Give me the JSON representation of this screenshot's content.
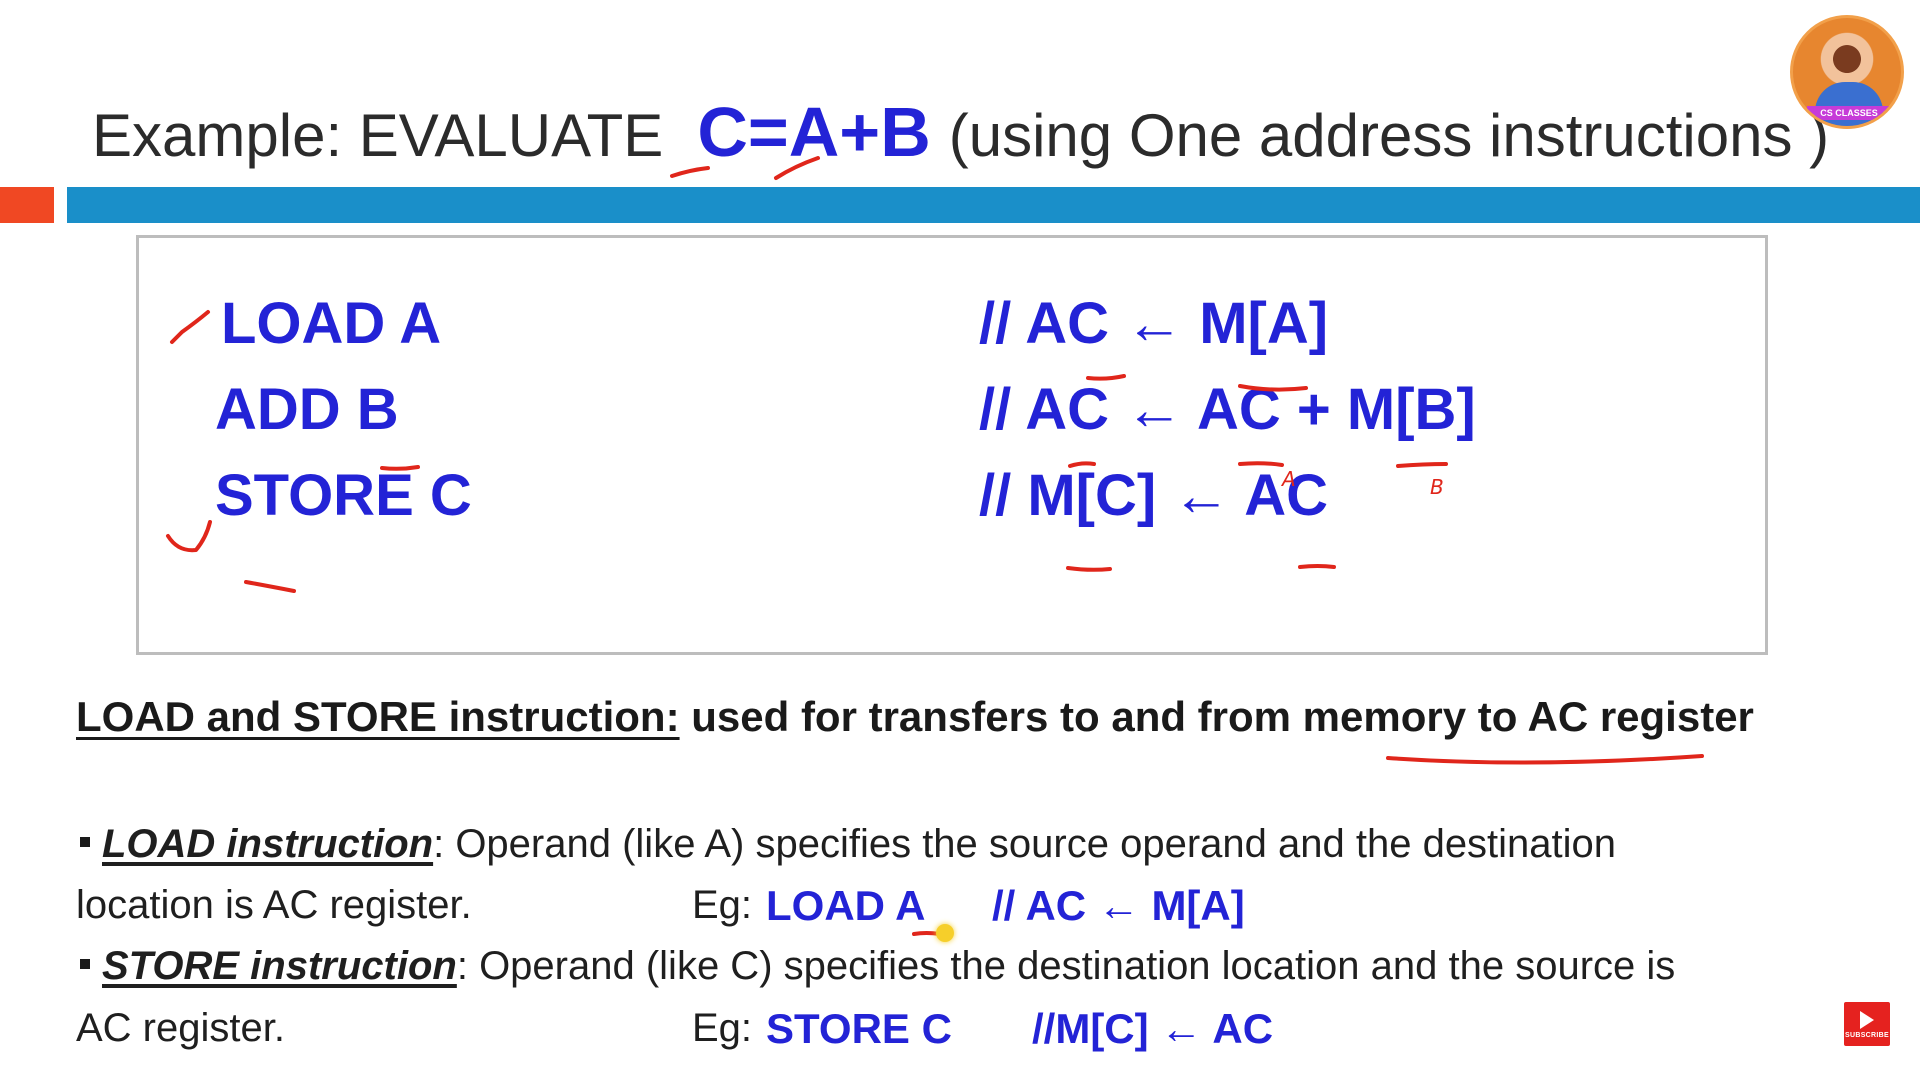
{
  "title": {
    "prefix": "Example: EVALUATE",
    "expression": "C=A+B",
    "suffix": "(using One address instructions )"
  },
  "code_example": {
    "instructions": [
      "LOAD A",
      "ADD  B",
      "STORE C"
    ],
    "comments": [
      "// AC ← M[A]",
      "// AC ← AC + M[B]",
      "// M[C] ← AC"
    ]
  },
  "summary": {
    "heading_term": "LOAD and STORE instruction:",
    "heading_text": " used for transfers to and from memory to AC register"
  },
  "load_instruction": {
    "term": "LOAD instruction",
    "line1": ": Operand (like A) specifies the source operand and the destination",
    "line2": "location is AC register.",
    "eg_label": "Eg:",
    "eg_code": "LOAD A",
    "eg_comment": "// AC ← M[A]"
  },
  "store_instruction": {
    "term": "STORE instruction",
    "line1": ": Operand (like C) specifies the destination location and the source is",
    "line2": "AC register.",
    "eg_label": "Eg:",
    "eg_code": "STORE C",
    "eg_comment": "//M[C] ← AC"
  },
  "annotations": {
    "handwritten_1": "A",
    "handwritten_2": "B"
  },
  "presenter_badge": "CS CLASSES",
  "subscribe_button": "SUBSCRIBE",
  "colors": {
    "code_blue": "#2323d6",
    "accent_red": "#f04823",
    "accent_blue": "#1a8fc9",
    "ink_red": "#e0261b"
  }
}
